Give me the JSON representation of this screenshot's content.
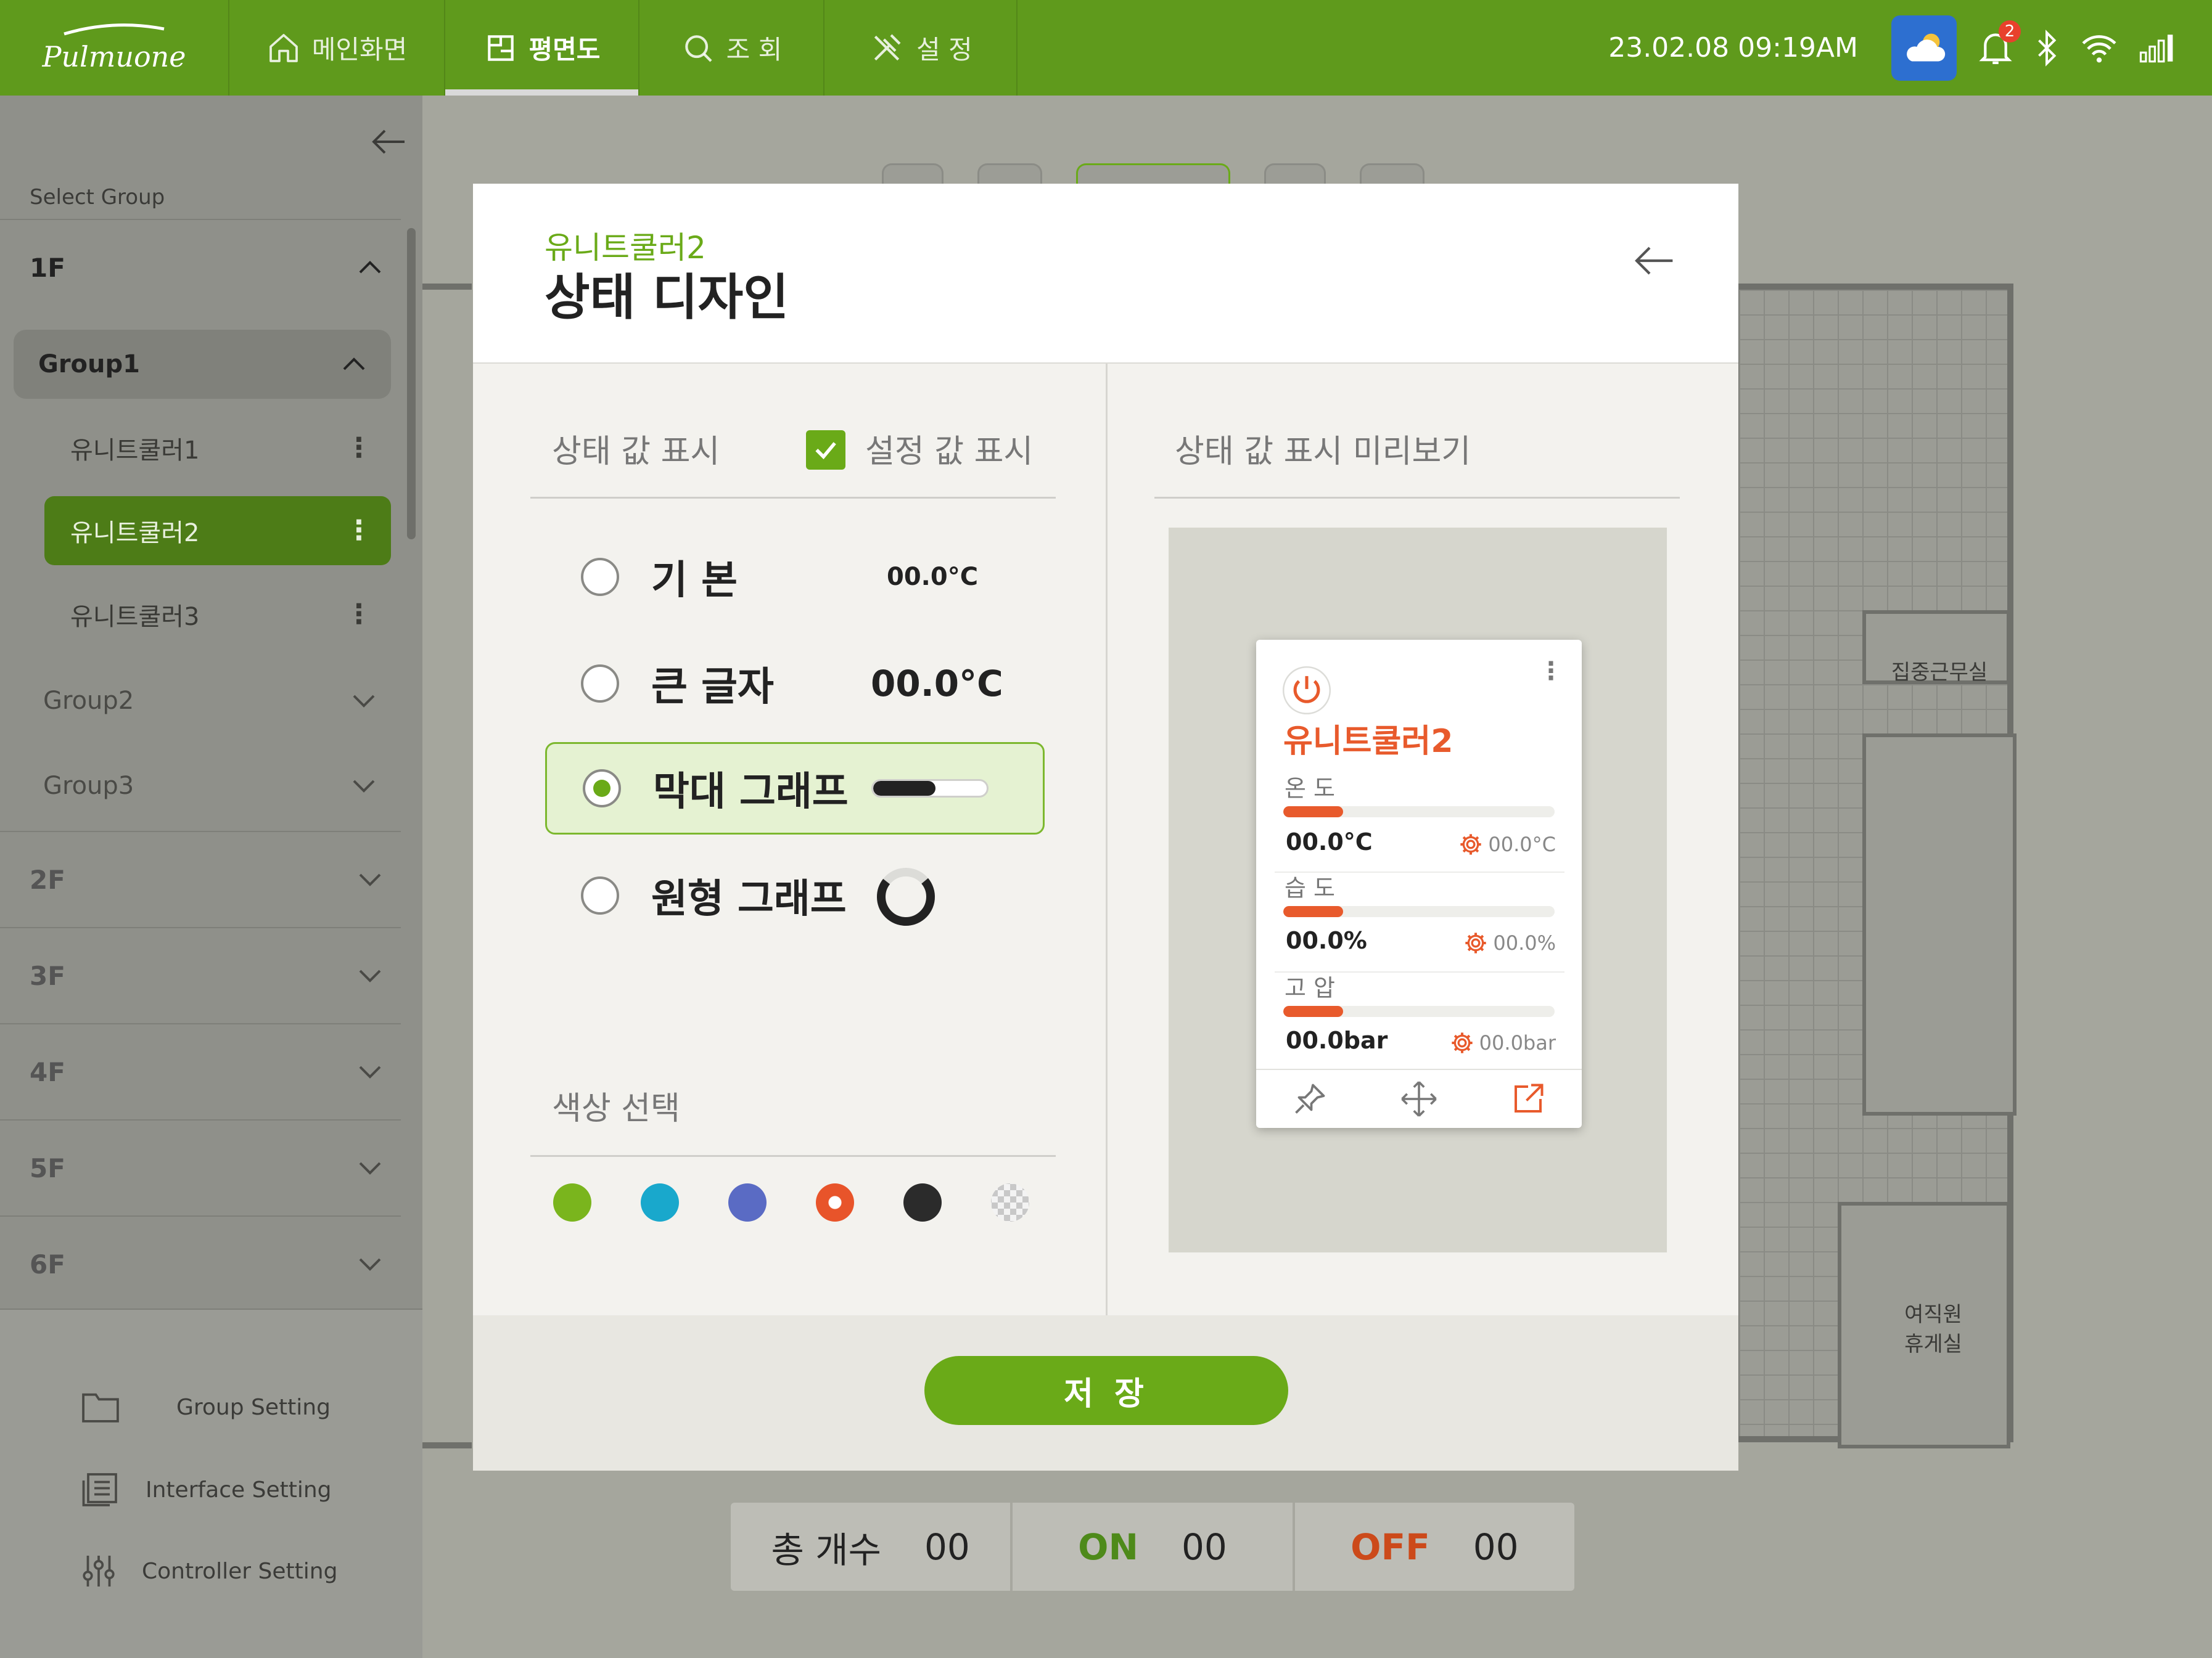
{
  "app": {
    "logo": "Pulmuone"
  },
  "nav": {
    "items": [
      {
        "label": "메인화면",
        "icon": "home-icon"
      },
      {
        "label": "평면도",
        "icon": "floorplan-icon",
        "active": true
      },
      {
        "label": "조 회",
        "icon": "search-icon"
      },
      {
        "label": "설 정",
        "icon": "tools-icon"
      }
    ]
  },
  "status": {
    "datetime": "23.02.08  09:19AM",
    "notifications": "2"
  },
  "sidebar": {
    "select_group": "Select Group",
    "floors": [
      "1F",
      "2F",
      "3F",
      "4F",
      "5F",
      "6F"
    ],
    "group1": "Group1",
    "units": [
      "유니트쿨러1",
      "유니트쿨러2",
      "유니트쿨러3"
    ],
    "groups": [
      "Group2",
      "Group3"
    ],
    "settings": [
      "Group Setting",
      "Interface Setting",
      "Controller Setting"
    ]
  },
  "plan": {
    "room1": "집중근무실",
    "room2": "여직원\n휴게실"
  },
  "summary": {
    "total_label": "총 개수",
    "total": "00",
    "on_label": "ON",
    "on": "00",
    "off_label": "OFF",
    "off": "00"
  },
  "modal": {
    "subtitle": "유니트쿨러2",
    "title": "상태 디자인",
    "status_display": "상태 값 표시",
    "setting_display": "설정 값 표시",
    "preview_label": "상태 값 표시 미리보기",
    "options": [
      {
        "label": "기 본",
        "value": "00.0°C"
      },
      {
        "label": "큰 글자",
        "value": "00.0°C"
      },
      {
        "label": "막대 그래프"
      },
      {
        "label": "원형 그래프"
      }
    ],
    "color_label": "색상 선택",
    "colors": [
      "#7ab51d",
      "#19a8cc",
      "#5a6bc4",
      "#e8542a",
      "#2b2b2b",
      "#c8c8c8"
    ],
    "save": "저 장",
    "bar_fill_fraction": 0.55
  },
  "preview_card": {
    "name": "유니트쿨러2",
    "rows": [
      {
        "label": "온 도",
        "value": "00.0°C",
        "setting": "00.0°C",
        "fill_fraction": 0.22
      },
      {
        "label": "습 도",
        "value": "00.0%",
        "setting": "00.0%",
        "fill_fraction": 0.22
      },
      {
        "label": "고 압",
        "value": "00.0bar",
        "setting": "00.0bar",
        "fill_fraction": 0.22
      }
    ]
  }
}
